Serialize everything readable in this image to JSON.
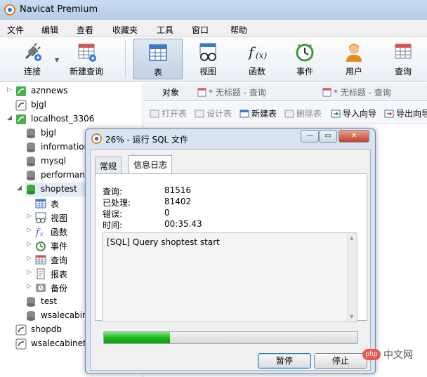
{
  "app": {
    "title": "Navicat Premium"
  },
  "menu": [
    "文件",
    "编辑",
    "查看",
    "收藏夹",
    "工具",
    "窗口",
    "帮助"
  ],
  "toolbar": {
    "connect": "连接",
    "new_query": "新建查询",
    "table": "表",
    "view": "视图",
    "function": "函数",
    "event": "事件",
    "user": "用户",
    "query": "查询"
  },
  "tree": [
    {
      "label": "aznnews"
    },
    {
      "label": "bjgl"
    },
    {
      "label": "localhost_3306"
    },
    {
      "label": "bjgl"
    },
    {
      "label": "information_schema"
    },
    {
      "label": "mysql"
    },
    {
      "label": "performance_schema"
    },
    {
      "label": "shoptest"
    },
    {
      "label": "表"
    },
    {
      "label": "视图"
    },
    {
      "label": "函数"
    },
    {
      "label": "事件"
    },
    {
      "label": "查询"
    },
    {
      "label": "报表"
    },
    {
      "label": "备份"
    },
    {
      "label": "test"
    },
    {
      "label": "wsalecabinet"
    },
    {
      "label": "shopdb"
    },
    {
      "label": "wsalecabinet"
    }
  ],
  "tabs": {
    "objects": "对象",
    "tab1": "* 无标题 - 查询",
    "tab2": "* 无标题 - 查询"
  },
  "subbar": {
    "open": "打开表",
    "design": "设计表",
    "new": "新建表",
    "delete": "删除表",
    "import": "导入向导",
    "export": "导出向导"
  },
  "dialog": {
    "title": "26% - 运行 SQL 文件",
    "tab_general": "常规",
    "tab_log": "信息日志",
    "rows": [
      {
        "k": "查询:",
        "v": "81516"
      },
      {
        "k": "已处理:",
        "v": "81402"
      },
      {
        "k": "错误:",
        "v": "0"
      },
      {
        "k": "时间:",
        "v": "00:35.43"
      }
    ],
    "log_line": "[SQL] Query shoptest start",
    "progress_percent": 26,
    "pause": "暂停",
    "stop": "停止"
  },
  "watermark": {
    "text": "中文网",
    "badge": "php"
  },
  "colors": {
    "accent": "#3c7fb1",
    "progress": "#18b318"
  }
}
